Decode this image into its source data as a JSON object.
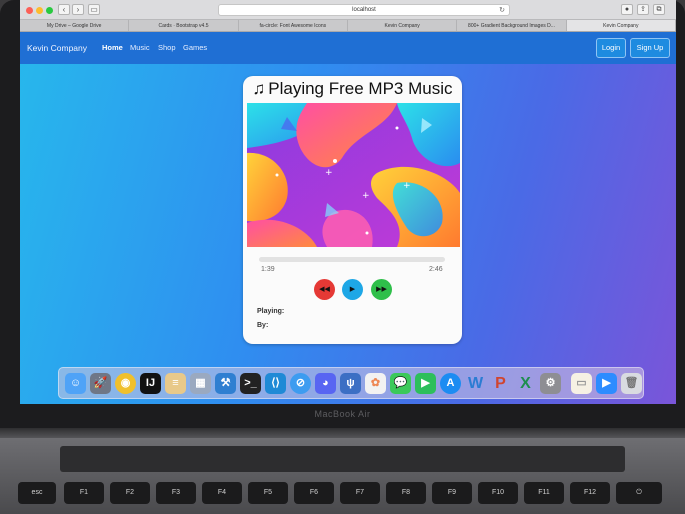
{
  "browser": {
    "url": "localhost",
    "tabs": [
      "My Drive – Google Drive",
      "Cards · Bootstrap v4.5",
      "fa-circle: Font Awesome Icons",
      "Kevin Company",
      "800+ Gradient Background Images D...",
      "Kevin Company"
    ],
    "active_tab": 5
  },
  "navbar": {
    "brand": "Kevin Company",
    "links": [
      "Home",
      "Music",
      "Shop",
      "Games"
    ],
    "login_label": "Login",
    "signup_label": "Sign Up",
    "color": "#1f6fd4"
  },
  "player": {
    "title": "Playing Free MP3 Music",
    "current_time": "1:39",
    "duration": "2:46",
    "playing_label": "Playing:",
    "by_label": "By:",
    "controls": {
      "rewind": {
        "icon": "backward-icon",
        "color": "#e53935"
      },
      "play": {
        "icon": "play-icon",
        "color": "#1ea7e6"
      },
      "forward": {
        "icon": "forward-icon",
        "color": "#2fbf4a"
      }
    }
  },
  "dock": {
    "icons": [
      "finder-icon",
      "launchpad-icon",
      "chrome-icon",
      "intellij-icon",
      "notes-icon",
      "preview-icon",
      "xcode-icon",
      "terminal-icon",
      "vscode-icon",
      "safari-icon",
      "discord-icon",
      "sourcetree-icon",
      "photos-icon",
      "messages-icon",
      "facetime-icon",
      "appstore-icon",
      "word-icon",
      "powerpoint-icon",
      "excel-icon",
      "system-preferences-icon",
      "folder-icon",
      "zoom-icon",
      "trash-icon"
    ],
    "word_glyph": "W",
    "powerpoint_glyph": "P",
    "excel_glyph": "X"
  },
  "laptop": {
    "model": "MacBook Air",
    "keys": [
      "esc",
      "F1",
      "F2",
      "F3",
      "F4",
      "F5",
      "F6",
      "F7",
      "F8",
      "F9",
      "F10",
      "F11",
      "F12",
      "⏻"
    ]
  }
}
